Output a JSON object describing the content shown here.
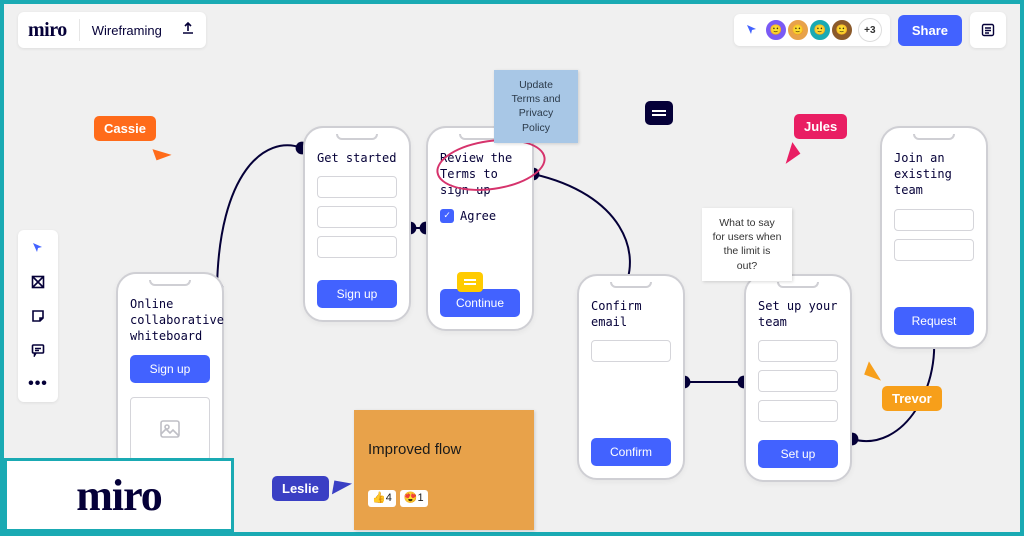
{
  "app": {
    "logo": "miro",
    "board_name": "Wireframing"
  },
  "collab": {
    "plus_count": "+3",
    "share": "Share"
  },
  "cursors": {
    "cassie": "Cassie",
    "jules": "Jules",
    "trevor": "Trevor",
    "leslie": "Leslie"
  },
  "phones": {
    "p1": {
      "title": "Online collaborative whiteboard",
      "button": "Sign up"
    },
    "p2": {
      "title": "Get started",
      "button": "Sign up"
    },
    "p3": {
      "title": "Review the Terms to sign up",
      "agree": "Agree",
      "button": "Continue"
    },
    "p4": {
      "title": "Confirm email",
      "button": "Confirm"
    },
    "p5": {
      "title": "Set up your team",
      "button": "Set up"
    },
    "p6": {
      "title": "Join an existing team",
      "button": "Request"
    }
  },
  "stickies": {
    "update": "Update Terms and Privacy Policy",
    "limit": "What to say for users when the limit is out?",
    "improved": "Improved flow",
    "react1": "👍4",
    "react2": "😍1"
  },
  "avatars": {
    "a1_bg": "#7a5af5",
    "a2_bg": "#e8a24a",
    "a3_bg": "#1aaab3",
    "a4_bg": "#8b5a2b"
  }
}
